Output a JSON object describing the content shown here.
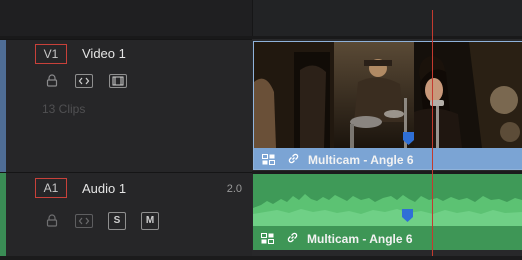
{
  "tracks": {
    "video": {
      "badge": "V1",
      "name": "Video 1",
      "clip_count": "13 Clips",
      "controls": [
        "lock-icon",
        "auto-select-icon",
        "disable-track-icon"
      ]
    },
    "audio": {
      "badge": "A1",
      "name": "Audio 1",
      "level": "2.0",
      "controls": [
        "lock-icon",
        "auto-select-icon",
        "solo-button",
        "mute-button"
      ],
      "solo_label": "S",
      "mute_label": "M"
    }
  },
  "clips": {
    "video": {
      "title": "Multicam - Angle 6",
      "color": "#6d99cc"
    },
    "audio": {
      "title": "Multicam - Angle 6",
      "color": "#3f9a58"
    }
  },
  "colors": {
    "playhead": "#c43a2f",
    "video_track": "#4f6d95",
    "audio_track": "#3a8c55",
    "badge_border": "#c8413a",
    "marker": "#2f6fd6"
  }
}
